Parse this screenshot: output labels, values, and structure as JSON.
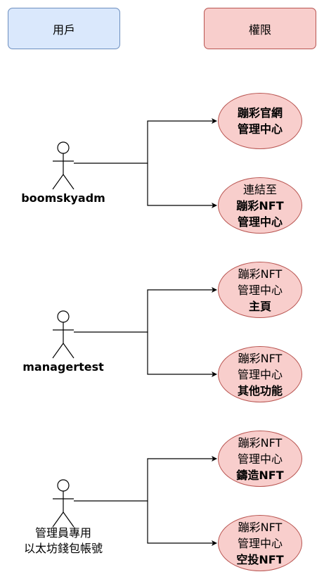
{
  "headers": {
    "users": "用戶",
    "permissions": "權限"
  },
  "actors": [
    {
      "label_lines": [
        "boomskyadm"
      ],
      "bold": true
    },
    {
      "label_lines": [
        "managertest"
      ],
      "bold": true
    },
    {
      "label_lines": [
        "管理員專用",
        "以太坊錢包帳號"
      ],
      "bold": false
    }
  ],
  "permissions": [
    {
      "lines": [
        {
          "text": "蹦彩官網",
          "bold": true
        },
        {
          "text": "管理中心",
          "bold": true
        }
      ]
    },
    {
      "lines": [
        {
          "text": "連結至",
          "bold": false
        },
        {
          "text": "蹦彩NFT",
          "bold": true
        },
        {
          "text": "管理中心",
          "bold": true
        }
      ]
    },
    {
      "lines": [
        {
          "text": "蹦彩NFT",
          "bold": false
        },
        {
          "text": "管理中心",
          "bold": false
        },
        {
          "text": "主頁",
          "bold": true
        }
      ]
    },
    {
      "lines": [
        {
          "text": "蹦彩NFT",
          "bold": false
        },
        {
          "text": "管理中心",
          "bold": false
        },
        {
          "text": "其他功能",
          "bold": true
        }
      ]
    },
    {
      "lines": [
        {
          "text": "蹦彩NFT",
          "bold": false
        },
        {
          "text": "管理中心",
          "bold": false
        },
        {
          "text": "鑄造NFT",
          "bold": true
        }
      ]
    },
    {
      "lines": [
        {
          "text": "蹦彩NFT",
          "bold": false
        },
        {
          "text": "管理中心",
          "bold": false
        },
        {
          "text": "空投NFT",
          "bold": true
        }
      ]
    }
  ],
  "colors": {
    "user_fill": "#dae8fc",
    "user_stroke": "#6c8ebf",
    "perm_fill": "#f8cecc",
    "perm_stroke": "#b85450"
  }
}
